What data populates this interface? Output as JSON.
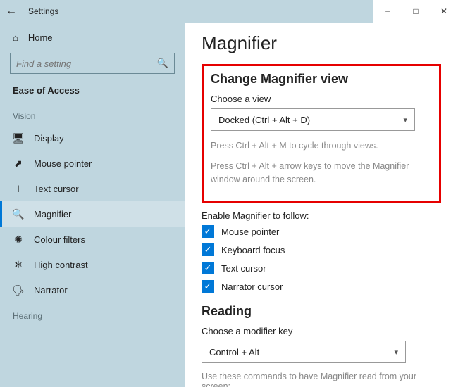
{
  "titlebar": {
    "title": "Settings"
  },
  "sidebar": {
    "home": "Home",
    "search_placeholder": "Find a setting",
    "category": "Ease of Access",
    "group_vision": "Vision",
    "group_hearing": "Hearing",
    "items": [
      {
        "label": "Display"
      },
      {
        "label": "Mouse pointer"
      },
      {
        "label": "Text cursor"
      },
      {
        "label": "Magnifier"
      },
      {
        "label": "Colour filters"
      },
      {
        "label": "High contrast"
      },
      {
        "label": "Narrator"
      }
    ]
  },
  "main": {
    "title": "Magnifier",
    "section_view": {
      "heading": "Change Magnifier view",
      "choose_label": "Choose a view",
      "selected": "Docked (Ctrl + Alt + D)",
      "hint1": "Press Ctrl + Alt + M to cycle through views.",
      "hint2": "Press Ctrl + Alt + arrow keys to move the Magnifier window around the screen."
    },
    "follow": {
      "heading": "Enable Magnifier to follow:",
      "items": [
        {
          "label": "Mouse pointer",
          "checked": true
        },
        {
          "label": "Keyboard focus",
          "checked": true
        },
        {
          "label": "Text cursor",
          "checked": true
        },
        {
          "label": "Narrator cursor",
          "checked": true
        }
      ]
    },
    "reading": {
      "heading": "Reading",
      "modifier_label": "Choose a modifier key",
      "modifier_value": "Control + Alt",
      "footer": "Use these commands to have Magnifier read from your screen:"
    }
  }
}
